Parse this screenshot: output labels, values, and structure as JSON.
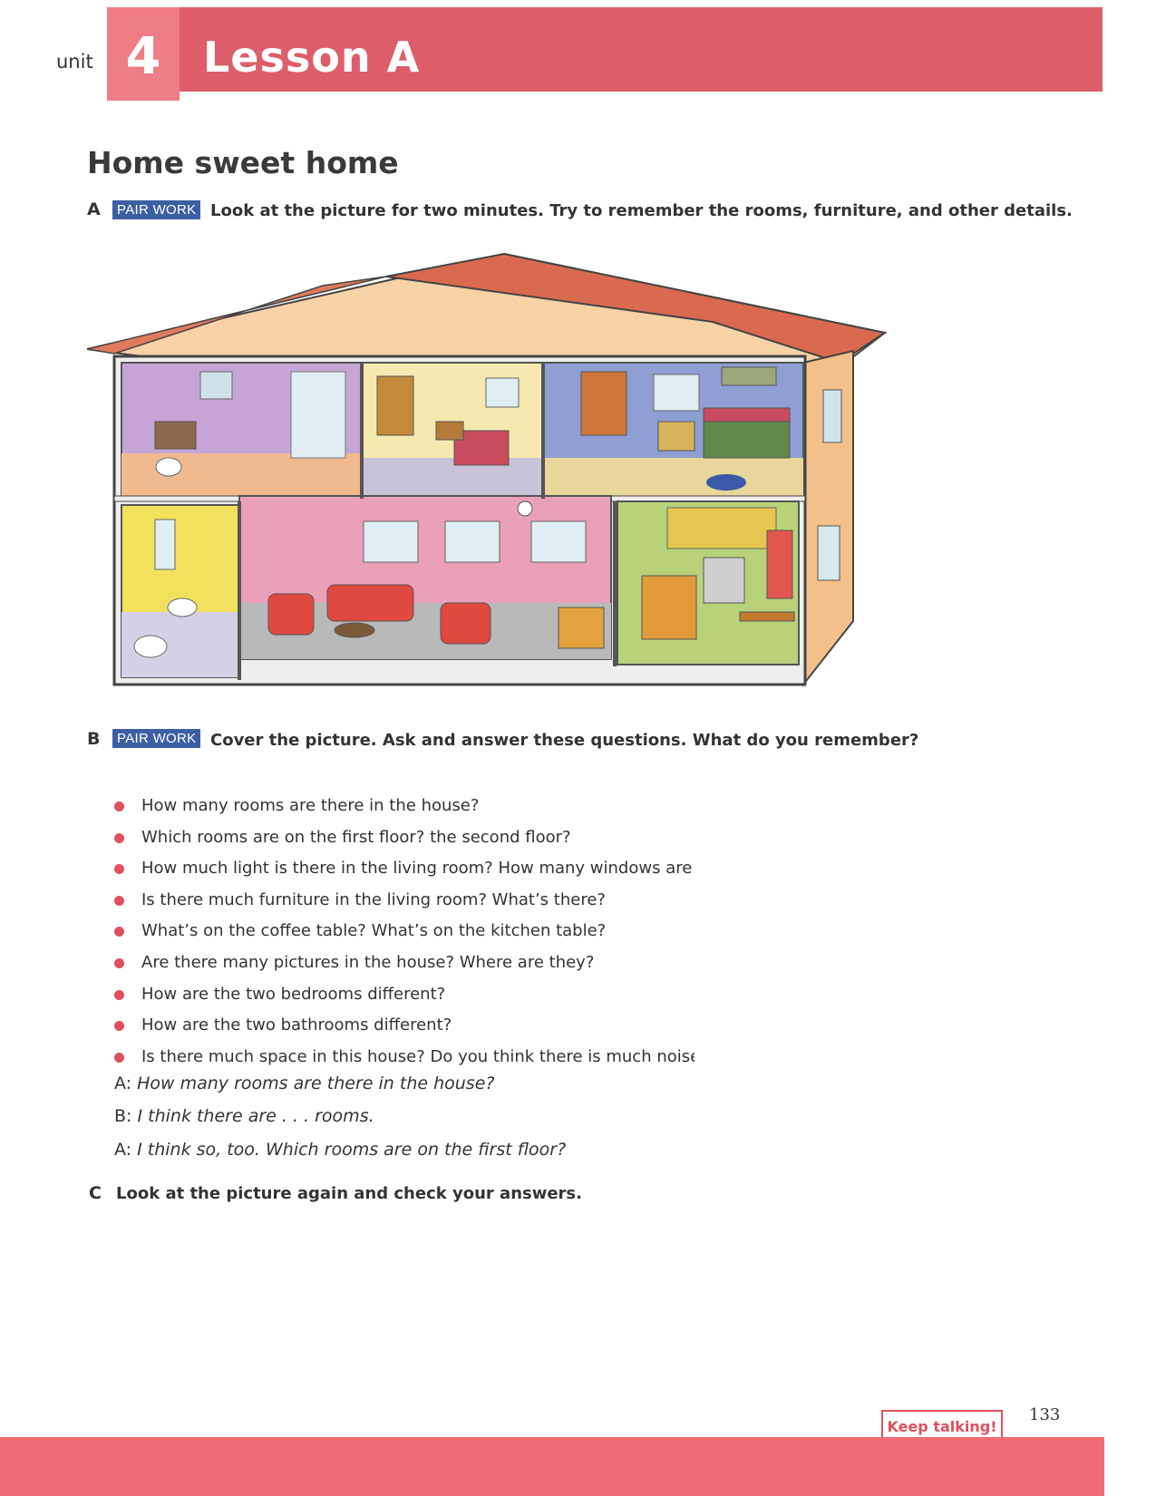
{
  "header": {
    "unit_label": "unit",
    "unit_number": "4",
    "lesson_title": "Lesson A"
  },
  "page_title": "Home sweet home",
  "section_a": {
    "letter": "A",
    "badge": "PAIR WORK",
    "instruction": "Look at the picture for two minutes. Try to remember the rooms, furniture, and other details."
  },
  "section_b": {
    "letter": "B",
    "badge": "PAIR WORK",
    "instruction": "Cover the picture. Ask and answer these questions. What do you remember?",
    "questions": [
      "How many rooms are there in the house?",
      "Which rooms are on the first floor? the second floor?",
      "How much light is there in the living room? How many windows are there?",
      "Is there much furniture in the living room? What’s there?",
      "What’s on the coffee table? What’s on the kitchen table?",
      "Are there many pictures in the house? Where are they?",
      "How are the two bedrooms different?",
      "How are the two bathrooms different?",
      "Is there much space in this house? Do you think there is much noise?"
    ],
    "dialogue": [
      {
        "speaker": "A:",
        "line": "How many rooms are there in the house?"
      },
      {
        "speaker": "B:",
        "line": "I think there are . . . rooms."
      },
      {
        "speaker": "A:",
        "line": "I think so, too. Which rooms are on the first floor?"
      }
    ]
  },
  "section_c": {
    "letter": "C",
    "instruction": "Look at the picture again and check your answers."
  },
  "footer": {
    "keep_talking": "Keep talking!",
    "page_number": "133"
  },
  "colors": {
    "accent": "#dd5e6a",
    "badge": "#3c5fa4",
    "bullet": "#e0515e"
  }
}
